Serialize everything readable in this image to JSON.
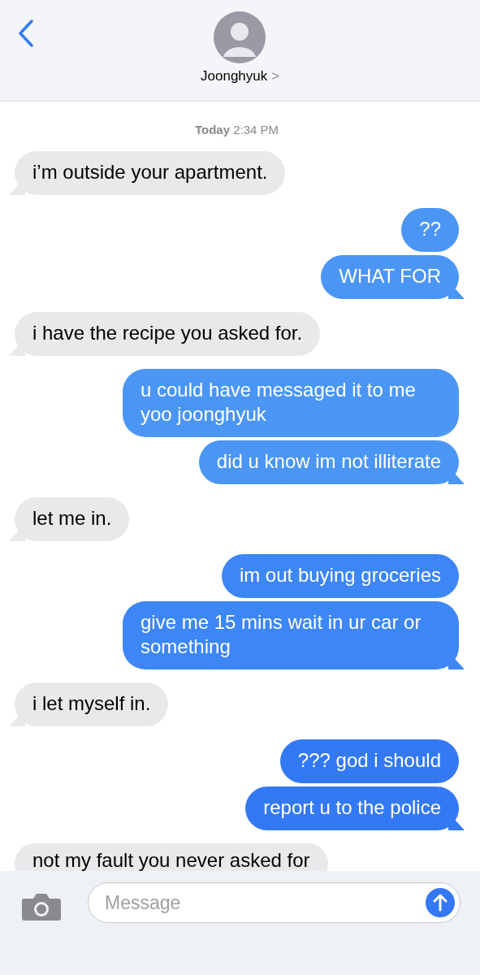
{
  "header": {
    "contact_name": "Joonghyuk",
    "chevron": ">"
  },
  "timestamp": {
    "day": "Today",
    "time": "2:34 PM"
  },
  "messages": [
    {
      "kind": "received",
      "text": "i’m outside your apartment.",
      "tail": true,
      "group_start": true
    },
    {
      "kind": "sent",
      "text": "??",
      "tail": false,
      "group_start": true
    },
    {
      "kind": "sent",
      "text": "WHAT FOR",
      "tail": true,
      "group_start": false
    },
    {
      "kind": "received",
      "text": "i have the recipe you asked for.",
      "tail": true,
      "group_start": true
    },
    {
      "kind": "sent",
      "text": "u could have messaged it to me yoo joonghyuk",
      "tail": false,
      "group_start": true
    },
    {
      "kind": "sent",
      "text": "did u know im not illiterate",
      "tail": true,
      "group_start": false
    },
    {
      "kind": "received",
      "text": "let me in.",
      "tail": true,
      "group_start": true
    },
    {
      "kind": "sent",
      "text": "im out buying groceries",
      "tail": false,
      "group_start": true
    },
    {
      "kind": "sent",
      "text": "give me 15 mins wait in ur car or something",
      "tail": true,
      "group_start": false
    },
    {
      "kind": "received",
      "text": "i let myself in.",
      "tail": true,
      "group_start": true
    },
    {
      "kind": "sent",
      "text": "??? god i should",
      "tail": false,
      "group_start": true
    },
    {
      "kind": "sent",
      "text": "report u to the police",
      "tail": true,
      "group_start": false
    },
    {
      "kind": "received",
      "text": "not my fault you never asked for",
      "tail": false,
      "group_start": true
    }
  ],
  "composer": {
    "placeholder": "Message"
  }
}
